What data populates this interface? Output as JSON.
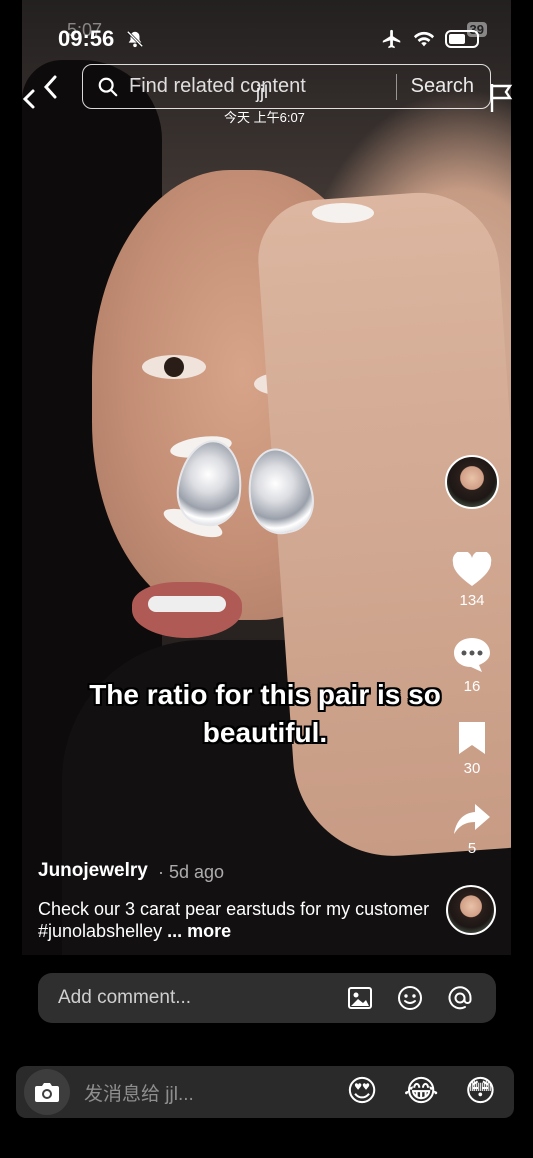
{
  "status_bar": {
    "time": "09:56",
    "ghost_time": "5:07",
    "battery_badge": "39"
  },
  "search": {
    "placeholder": "Find related content",
    "button_label": "Search"
  },
  "overlay": {
    "ghost_name": "jjl",
    "ghost_date": "今天 上午6:07"
  },
  "video": {
    "caption": "The ratio for this pair is so beautiful."
  },
  "actions": {
    "likes": "134",
    "comments": "16",
    "saves": "30",
    "shares": "5"
  },
  "post": {
    "author": "Junojewelry",
    "age": "· 5d ago",
    "description": "Check our 3 carat pear earstuds for my customer #junolabshelley",
    "more_label": "... more"
  },
  "comment_bar": {
    "placeholder": "Add comment..."
  },
  "message_bar": {
    "placeholder": "发消息给 jjl...",
    "emojis": [
      "😍",
      "😂",
      "😳"
    ]
  },
  "colors": {
    "comment_bar_bg": "#2f2f2f",
    "message_bar_bg": "#2a2a2a",
    "like_color": "#ffffff"
  }
}
